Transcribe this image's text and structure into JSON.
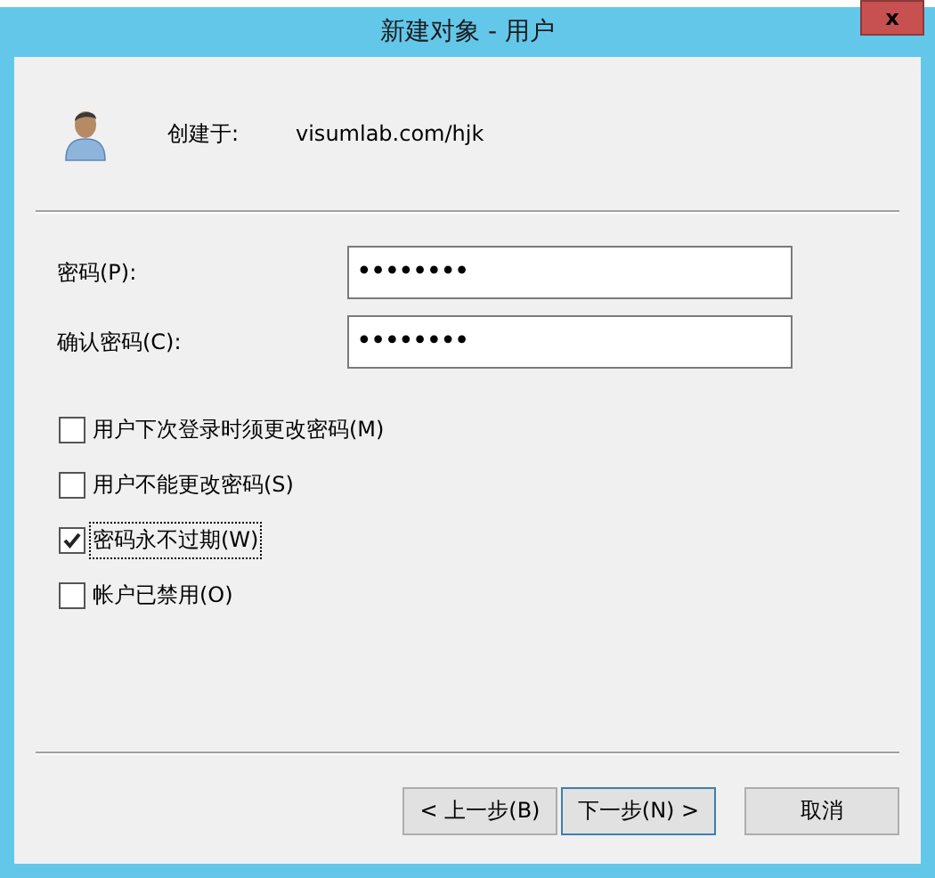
{
  "window": {
    "title": "新建对象 - 用户",
    "close": "x"
  },
  "created_in": {
    "label": "创建于:",
    "value": "visumlab.com/hjk"
  },
  "fields": [
    {
      "label": "密码(P):",
      "value": "••••••••"
    },
    {
      "label": "确认密码(C):",
      "value": "••••••••"
    }
  ],
  "options": [
    {
      "label": "用户下次登录时须更改密码(M)",
      "checked": false,
      "focused": false
    },
    {
      "label": "用户不能更改密码(S)",
      "checked": false,
      "focused": false
    },
    {
      "label": "密码永不过期(W)",
      "checked": true,
      "focused": true
    },
    {
      "label": "帐户已禁用(O)",
      "checked": false,
      "focused": false
    }
  ],
  "buttons": [
    {
      "label": "< 上一步(B)",
      "default": false
    },
    {
      "label": "下一步(N) >",
      "default": true
    },
    {
      "label": "取消",
      "default": false
    }
  ]
}
